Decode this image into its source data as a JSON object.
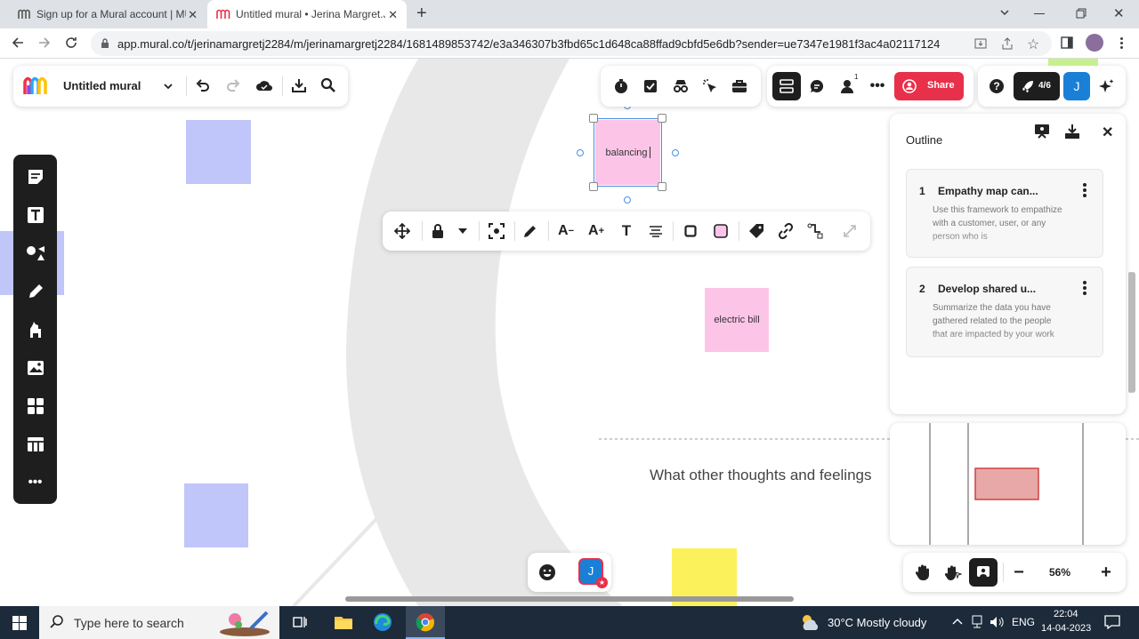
{
  "browser": {
    "tabs": [
      {
        "title": "Sign up for a Mural account | MU",
        "active": false
      },
      {
        "title": "Untitled mural • Jerina Margret.J",
        "active": true
      }
    ],
    "url": "app.mural.co/t/jerinamargretj2284/m/jerinamargretj2284/1681489853742/e3a346307b3fbd65c1d648ca88ffad9cbfd5e6db?sender=ue7347e1981f3ac4a02117124"
  },
  "mural": {
    "title": "Untitled mural",
    "share_label": "Share",
    "collab_count": "4/6",
    "user_initial": "J",
    "participant_badge": "1"
  },
  "canvas": {
    "sticky_selected": "balancing",
    "sticky_electric": "electric bill",
    "section_prompt": "What other thoughts and feelings"
  },
  "outline": {
    "title": "Outline",
    "items": [
      {
        "num": "1",
        "title": "Empathy map can...",
        "desc": "Use this framework to empathize with a customer, user, or any person who is"
      },
      {
        "num": "2",
        "title": "Develop shared u...",
        "desc": "Summarize the data you have gathered related to the people that are impacted by your work"
      }
    ]
  },
  "zoom": {
    "value": "56%"
  },
  "taskbar": {
    "search_placeholder": "Type here to search",
    "weather": "30°C  Mostly cloudy",
    "language": "ENG",
    "time": "22:04",
    "date": "14-04-2023"
  },
  "colors": {
    "share_red": "#e8304a",
    "accent_blue": "#1a7fd6",
    "sticky_pink": "#fcc5e8",
    "sticky_blue": "#c0c6fa",
    "sticky_yellow": "#fbf15b"
  }
}
